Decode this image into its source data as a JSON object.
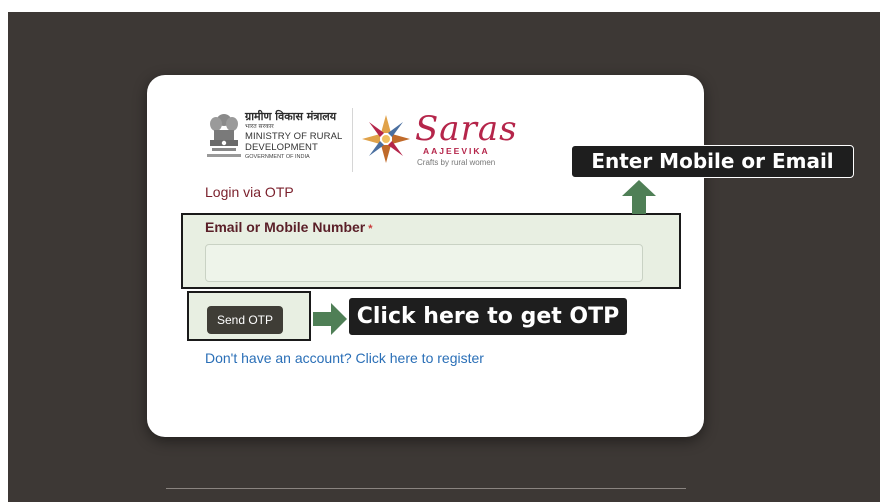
{
  "header": {
    "ministry_hindi": "ग्रामीण विकास मंत्रालय",
    "ministry_hindi_sub": "भारत सरकार",
    "ministry_line1": "MINISTRY OF RURAL",
    "ministry_line2": "DEVELOPMENT",
    "ministry_gov": "GOVERNMENT OF INDIA",
    "brand_name": "Saras",
    "brand_sub": "AAJEEVIKA",
    "brand_tagline": "Crafts by rural women"
  },
  "form": {
    "heading": "Login via OTP",
    "field_label": "Email or Mobile Number",
    "required_mark": "*",
    "field_value": "",
    "send_button": "Send OTP",
    "register_link": "Don't have an account? Click here to register"
  },
  "annotations": {
    "enter_hint": "Enter Mobile or Email",
    "otp_hint": "Click here to get OTP"
  },
  "colors": {
    "backdrop": "#3d3835",
    "heading": "#7a1f2b",
    "link": "#2a6fb7",
    "button": "#3f3d36",
    "arrow": "#4f7f56",
    "highlight": "#e8efe2",
    "brand": "#b5254a"
  }
}
